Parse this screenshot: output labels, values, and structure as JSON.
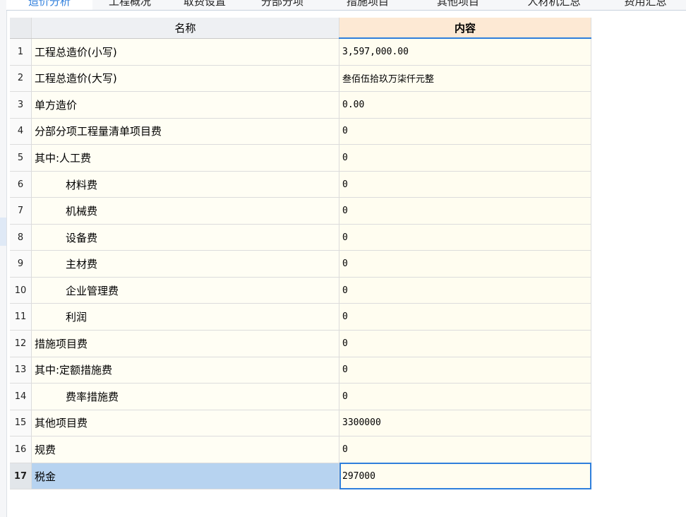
{
  "tabs": [
    {
      "label": "造价分析",
      "active": true
    },
    {
      "label": "工程概况",
      "active": false
    },
    {
      "label": "取费设置",
      "active": false
    },
    {
      "label": "分部分项",
      "active": false
    },
    {
      "label": "措施项目",
      "active": false
    },
    {
      "label": "其他项目",
      "active": false
    },
    {
      "label": "人材机汇总",
      "active": false
    },
    {
      "label": "费用汇总",
      "active": false
    }
  ],
  "table": {
    "columns": {
      "name": "名称",
      "content": "内容"
    },
    "selected_row": 17,
    "rows": [
      {
        "num": "1",
        "name": "工程总造价(小写)",
        "value": "3,597,000.00",
        "indent": false
      },
      {
        "num": "2",
        "name": "工程总造价(大写)",
        "value": "叁佰伍拾玖万柒仟元整",
        "indent": false
      },
      {
        "num": "3",
        "name": "单方造价",
        "value": "0.00",
        "indent": false
      },
      {
        "num": "4",
        "name": "分部分项工程量清单项目费",
        "value": "0",
        "indent": false
      },
      {
        "num": "5",
        "name": "其中:人工费",
        "value": "0",
        "indent": false
      },
      {
        "num": "6",
        "name": "材料费",
        "value": "0",
        "indent": true
      },
      {
        "num": "7",
        "name": "机械费",
        "value": "0",
        "indent": true
      },
      {
        "num": "8",
        "name": "设备费",
        "value": "0",
        "indent": true
      },
      {
        "num": "9",
        "name": "主材费",
        "value": "0",
        "indent": true
      },
      {
        "num": "10",
        "name": "企业管理费",
        "value": "0",
        "indent": true
      },
      {
        "num": "11",
        "name": "利润",
        "value": "0",
        "indent": true
      },
      {
        "num": "12",
        "name": "措施项目费",
        "value": "0",
        "indent": false
      },
      {
        "num": "13",
        "name": "其中:定额措施费",
        "value": "0",
        "indent": false
      },
      {
        "num": "14",
        "name": "费率措施费",
        "value": "0",
        "indent": true
      },
      {
        "num": "15",
        "name": "其他项目费",
        "value": "3300000",
        "indent": false
      },
      {
        "num": "16",
        "name": "规费",
        "value": "0",
        "indent": false
      },
      {
        "num": "17",
        "name": "税金",
        "value": "297000",
        "indent": false
      }
    ]
  }
}
